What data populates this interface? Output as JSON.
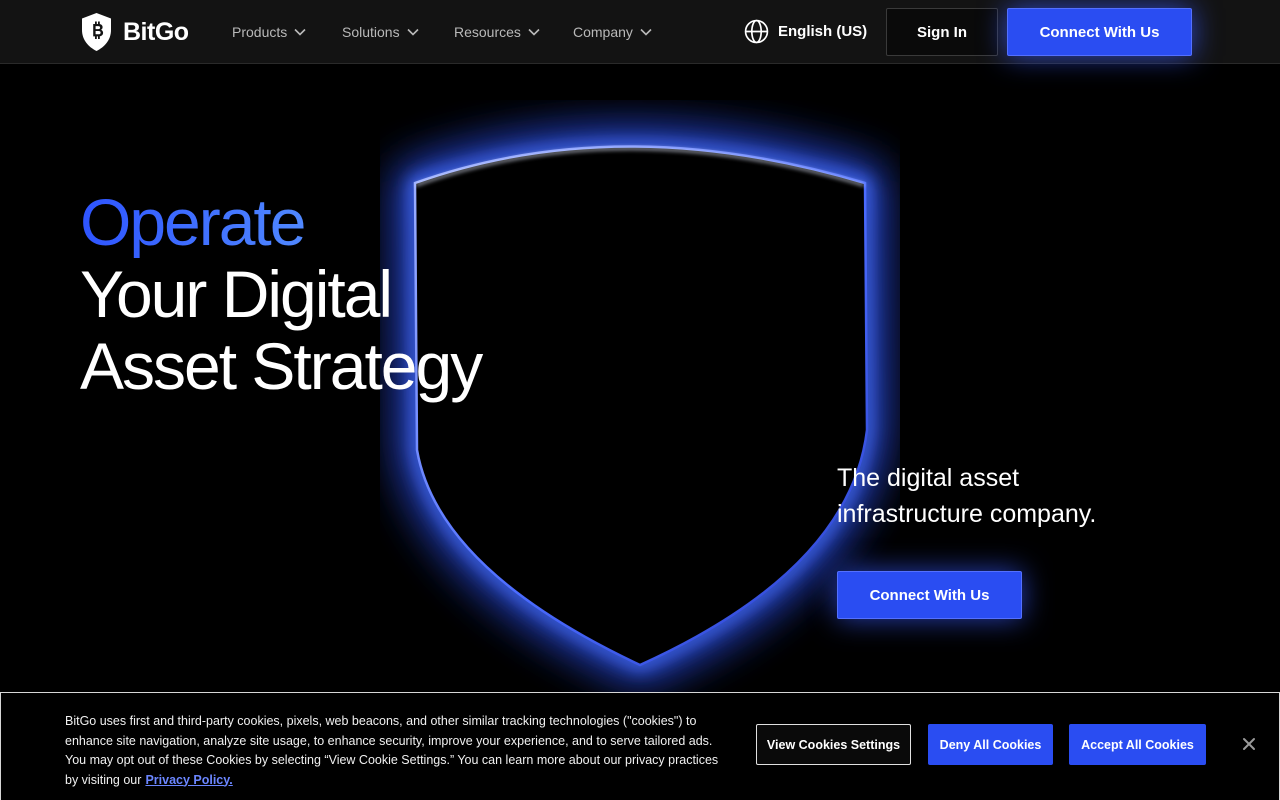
{
  "header": {
    "logo_text": "BitGo",
    "nav": [
      {
        "label": "Products"
      },
      {
        "label": "Solutions"
      },
      {
        "label": "Resources"
      },
      {
        "label": "Company"
      }
    ],
    "language_label": "English (US)",
    "sign_in_label": "Sign In",
    "connect_label": "Connect With Us"
  },
  "hero": {
    "headline_accent": "Operate",
    "headline_line2": "Your Digital",
    "headline_line3": "Asset Strategy",
    "tagline_line1": "The digital asset",
    "tagline_line2": "infrastructure company.",
    "cta_label": "Connect With Us"
  },
  "cookie_banner": {
    "text": "BitGo uses first and third-party cookies, pixels, web beacons, and other similar tracking technologies (\"cookies\") to enhance site navigation, analyze site usage, to enhance security, improve your experience, and to serve tailored ads. You may opt out of these Cookies by selecting “View Cookie Settings.” You can learn more about our privacy practices by visiting our",
    "link_label": "Privacy Policy.",
    "settings_label": "View Cookies Settings",
    "deny_label": "Deny All Cookies",
    "accept_label": "Accept All Cookies"
  },
  "colors": {
    "accent_blue": "#2a4df2",
    "header_bg": "#131313",
    "page_bg": "#000000",
    "link_blue": "#6b86ff"
  },
  "icons": {
    "logo": "bitcoin-shield-icon",
    "nav_chevron": "chevron-down-icon",
    "language": "globe-icon",
    "close": "close-icon"
  }
}
